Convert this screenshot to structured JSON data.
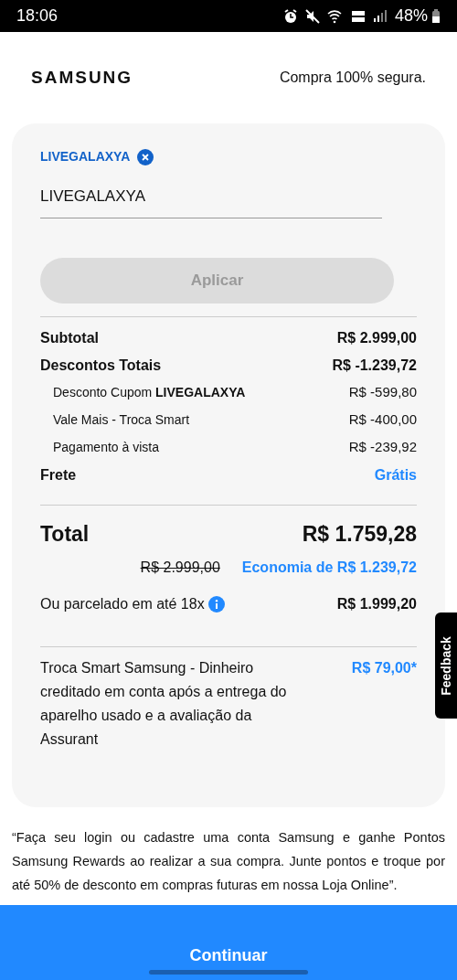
{
  "status_bar": {
    "time": "18:06",
    "battery": "48%"
  },
  "header": {
    "logo": "SAMSUNG",
    "secure_text": "Compra 100% segura."
  },
  "coupon": {
    "applied_code": "LIVEGALAXYA",
    "field": {
      "value": "LIVEGALAXYA"
    },
    "apply_button": {
      "label": "Aplicar",
      "disabled": true
    }
  },
  "summary": [
    {
      "kind": "main",
      "label": "Subtotal",
      "value": "R$ 2.999,00",
      "accent": false
    },
    {
      "kind": "main",
      "label": "Descontos Totais",
      "value": "R$ -1.239,72",
      "accent": false
    },
    {
      "kind": "sub",
      "label": "Desconto Cupom **LIVEGALAXYA**",
      "value": "R$ -599,80",
      "accent": false
    },
    {
      "kind": "sub",
      "label": "Vale Mais - Troca Smart",
      "value": "R$ -400,00",
      "accent": false
    },
    {
      "kind": "sub",
      "label": "Pagamento à vista",
      "value": "R$ -239,92",
      "accent": false
    },
    {
      "kind": "main",
      "label": "Frete",
      "value": "Grátis",
      "accent": true
    }
  ],
  "total": {
    "label": "Total",
    "value": "R$ 1.759,28",
    "old_price": "R$ 2.999,00",
    "savings": "Economia de R$ 1.239,72"
  },
  "installments": {
    "label": "Ou parcelado em até 18x",
    "value": "R$ 1.999,20"
  },
  "trade_in": {
    "text": "Troca Smart Samsung - Dinheiro creditado em conta após a entrega do aparelho usado e a avaliação da Assurant",
    "value": "R$ 79,00*"
  },
  "disclaimer": "“Faça seu login ou cadastre uma conta Samsung e ganhe Pontos Samsung Rewards ao realizar a sua compra. Junte pontos e troque por até 50% de desconto em compras futuras em nossa Loja Online”.",
  "feedback_tab": "Feedback",
  "continue_button": "Continuar"
}
